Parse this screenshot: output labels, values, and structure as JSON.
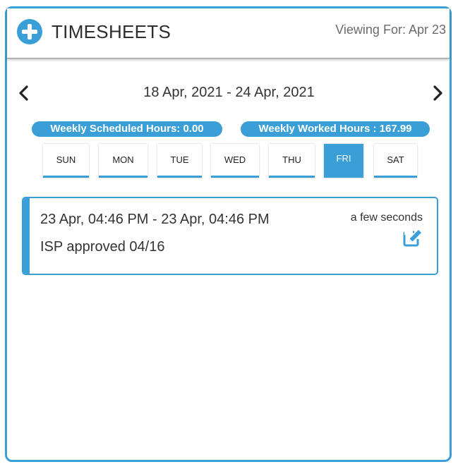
{
  "header": {
    "title": "TIMESHEETS",
    "viewing_for": "Viewing For: Apr 23",
    "add_icon": "plus-circle-icon"
  },
  "week": {
    "range": "18 Apr, 2021 - 24 Apr, 2021",
    "prev_icon": "chevron-left-icon",
    "next_icon": "chevron-right-icon",
    "scheduled_hours": "Weekly Scheduled Hours: 0.00",
    "worked_hours": "Weekly Worked Hours : 167.99",
    "days": [
      "SUN",
      "MON",
      "TUE",
      "WED",
      "THU",
      "FRI",
      "SAT"
    ],
    "selected_day": "FRI"
  },
  "entries": [
    {
      "time_range": "23 Apr, 04:46 PM - 23 Apr, 04:46 PM",
      "note": "ISP approved 04/16",
      "ago": "a few seconds",
      "edit_icon": "edit-icon"
    }
  ],
  "colors": {
    "accent": "#3a9fd6",
    "text": "#333333",
    "muted": "#6b6b6b"
  }
}
